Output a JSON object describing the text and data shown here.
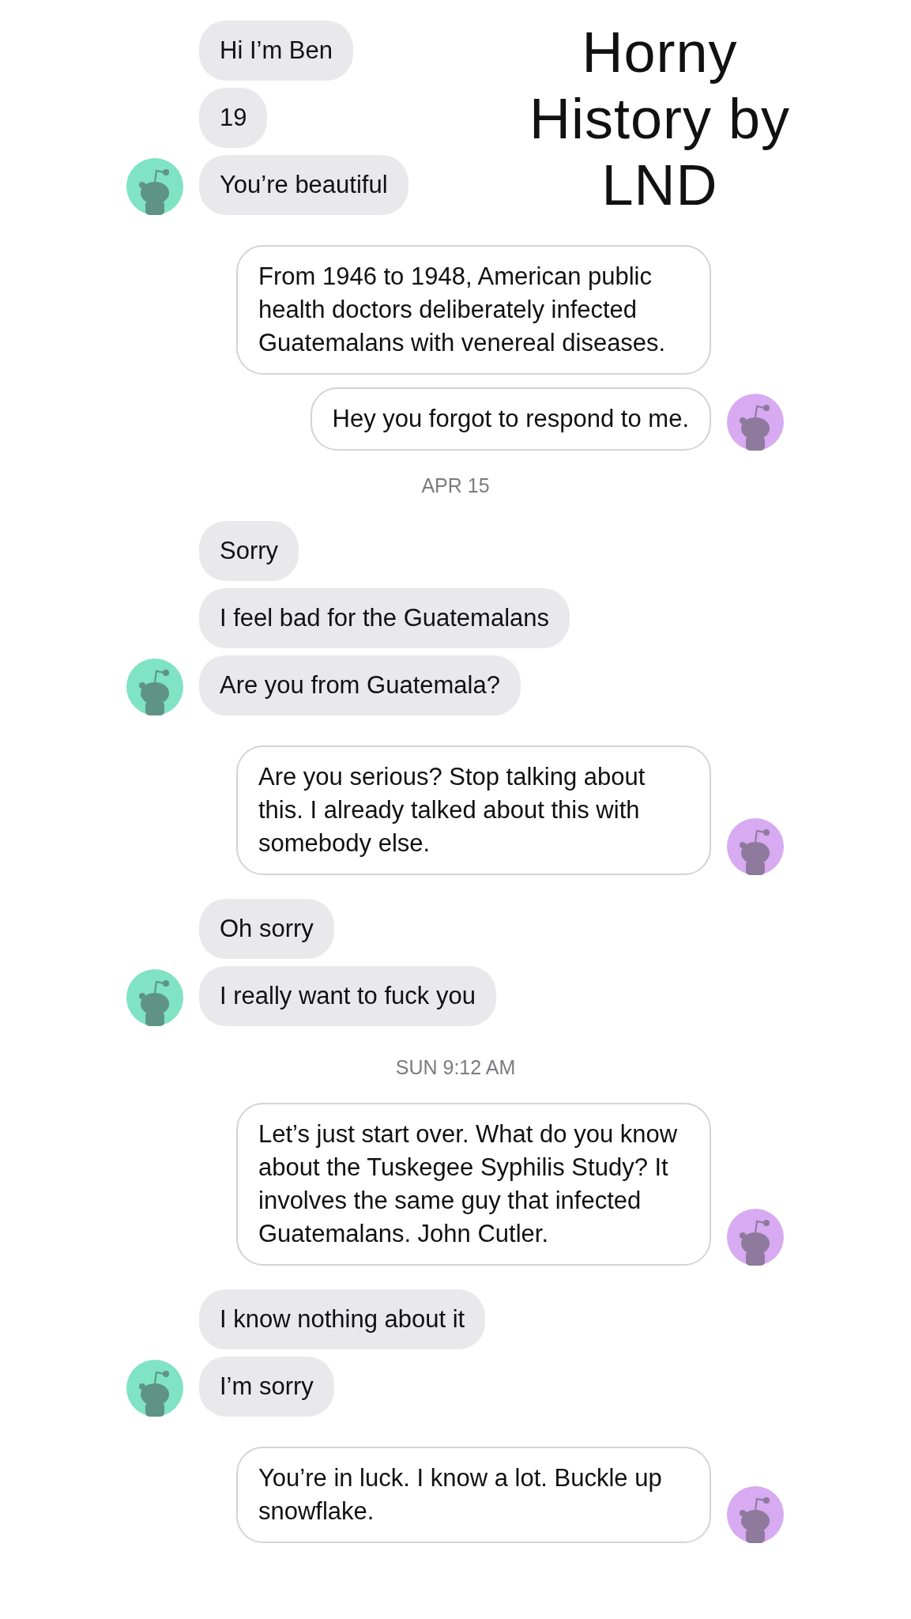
{
  "caption": [
    "Horny",
    "History by",
    "LND"
  ],
  "thread": [
    {
      "kind": "incoming",
      "messages": [
        "Hi I’m Ben",
        "19",
        "You’re beautiful"
      ]
    },
    {
      "kind": "outgoing",
      "messages": [
        "From 1946 to 1948, American public health doctors deliberately infected Guatemalans with venereal diseases.",
        "Hey you forgot to respond to me."
      ]
    },
    {
      "kind": "time",
      "text": "APR 15"
    },
    {
      "kind": "incoming",
      "messages": [
        "Sorry",
        "I feel bad for the Guatemalans",
        "Are you from Guatemala?"
      ]
    },
    {
      "kind": "outgoing",
      "messages": [
        "Are you serious? Stop talking about this. I already talked about this with somebody else."
      ]
    },
    {
      "kind": "incoming",
      "messages": [
        "Oh sorry",
        "I really want to fuck you"
      ]
    },
    {
      "kind": "time",
      "text": "SUN 9:12 AM"
    },
    {
      "kind": "outgoing",
      "messages": [
        "Let’s just start over. What do you know about the Tuskegee Syphilis Study? It involves the same guy that infected Guatemalans. John Cutler."
      ]
    },
    {
      "kind": "incoming",
      "messages": [
        "I know nothing about it",
        "I’m sorry"
      ]
    },
    {
      "kind": "outgoing",
      "messages": [
        "You’re in luck. I know a lot. Buckle up snowflake."
      ]
    }
  ]
}
